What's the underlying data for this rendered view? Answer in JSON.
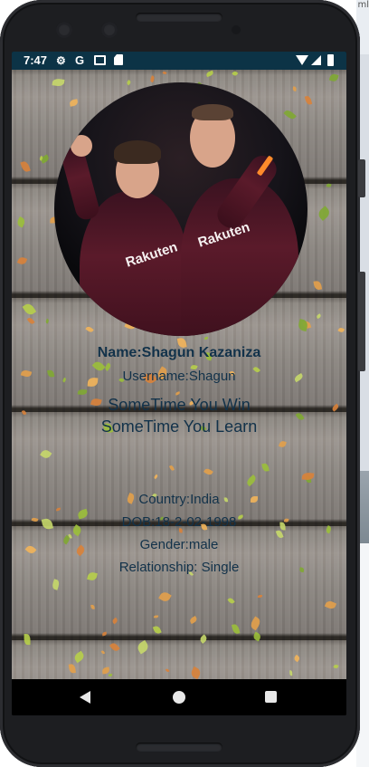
{
  "background": {
    "partial_text": "ml"
  },
  "status_bar": {
    "time": "7:47",
    "icons": [
      "gear-icon",
      "google-icon",
      "mail-icon",
      "sd-card-icon",
      "wifi-icon",
      "signal-icon",
      "battery-icon"
    ],
    "color": "#0c3346",
    "g_label": "G"
  },
  "profile": {
    "name": "Name:Shagun Kazaniza",
    "username": "Username:Shagun",
    "quote_line1": "SomeTime You Win",
    "quote_line2": "SomeTime You Learn",
    "country": "Country:India",
    "dob": "DOB:18-2-02-1998",
    "gender": "Gender:male",
    "relationship": "Relationship: Single",
    "text_color": "#12324a",
    "sponsor_left": "Rakuten",
    "sponsor_right": "Rakuten"
  },
  "nav_bar": {
    "icons": [
      "back-icon",
      "home-icon",
      "recents-icon"
    ]
  }
}
